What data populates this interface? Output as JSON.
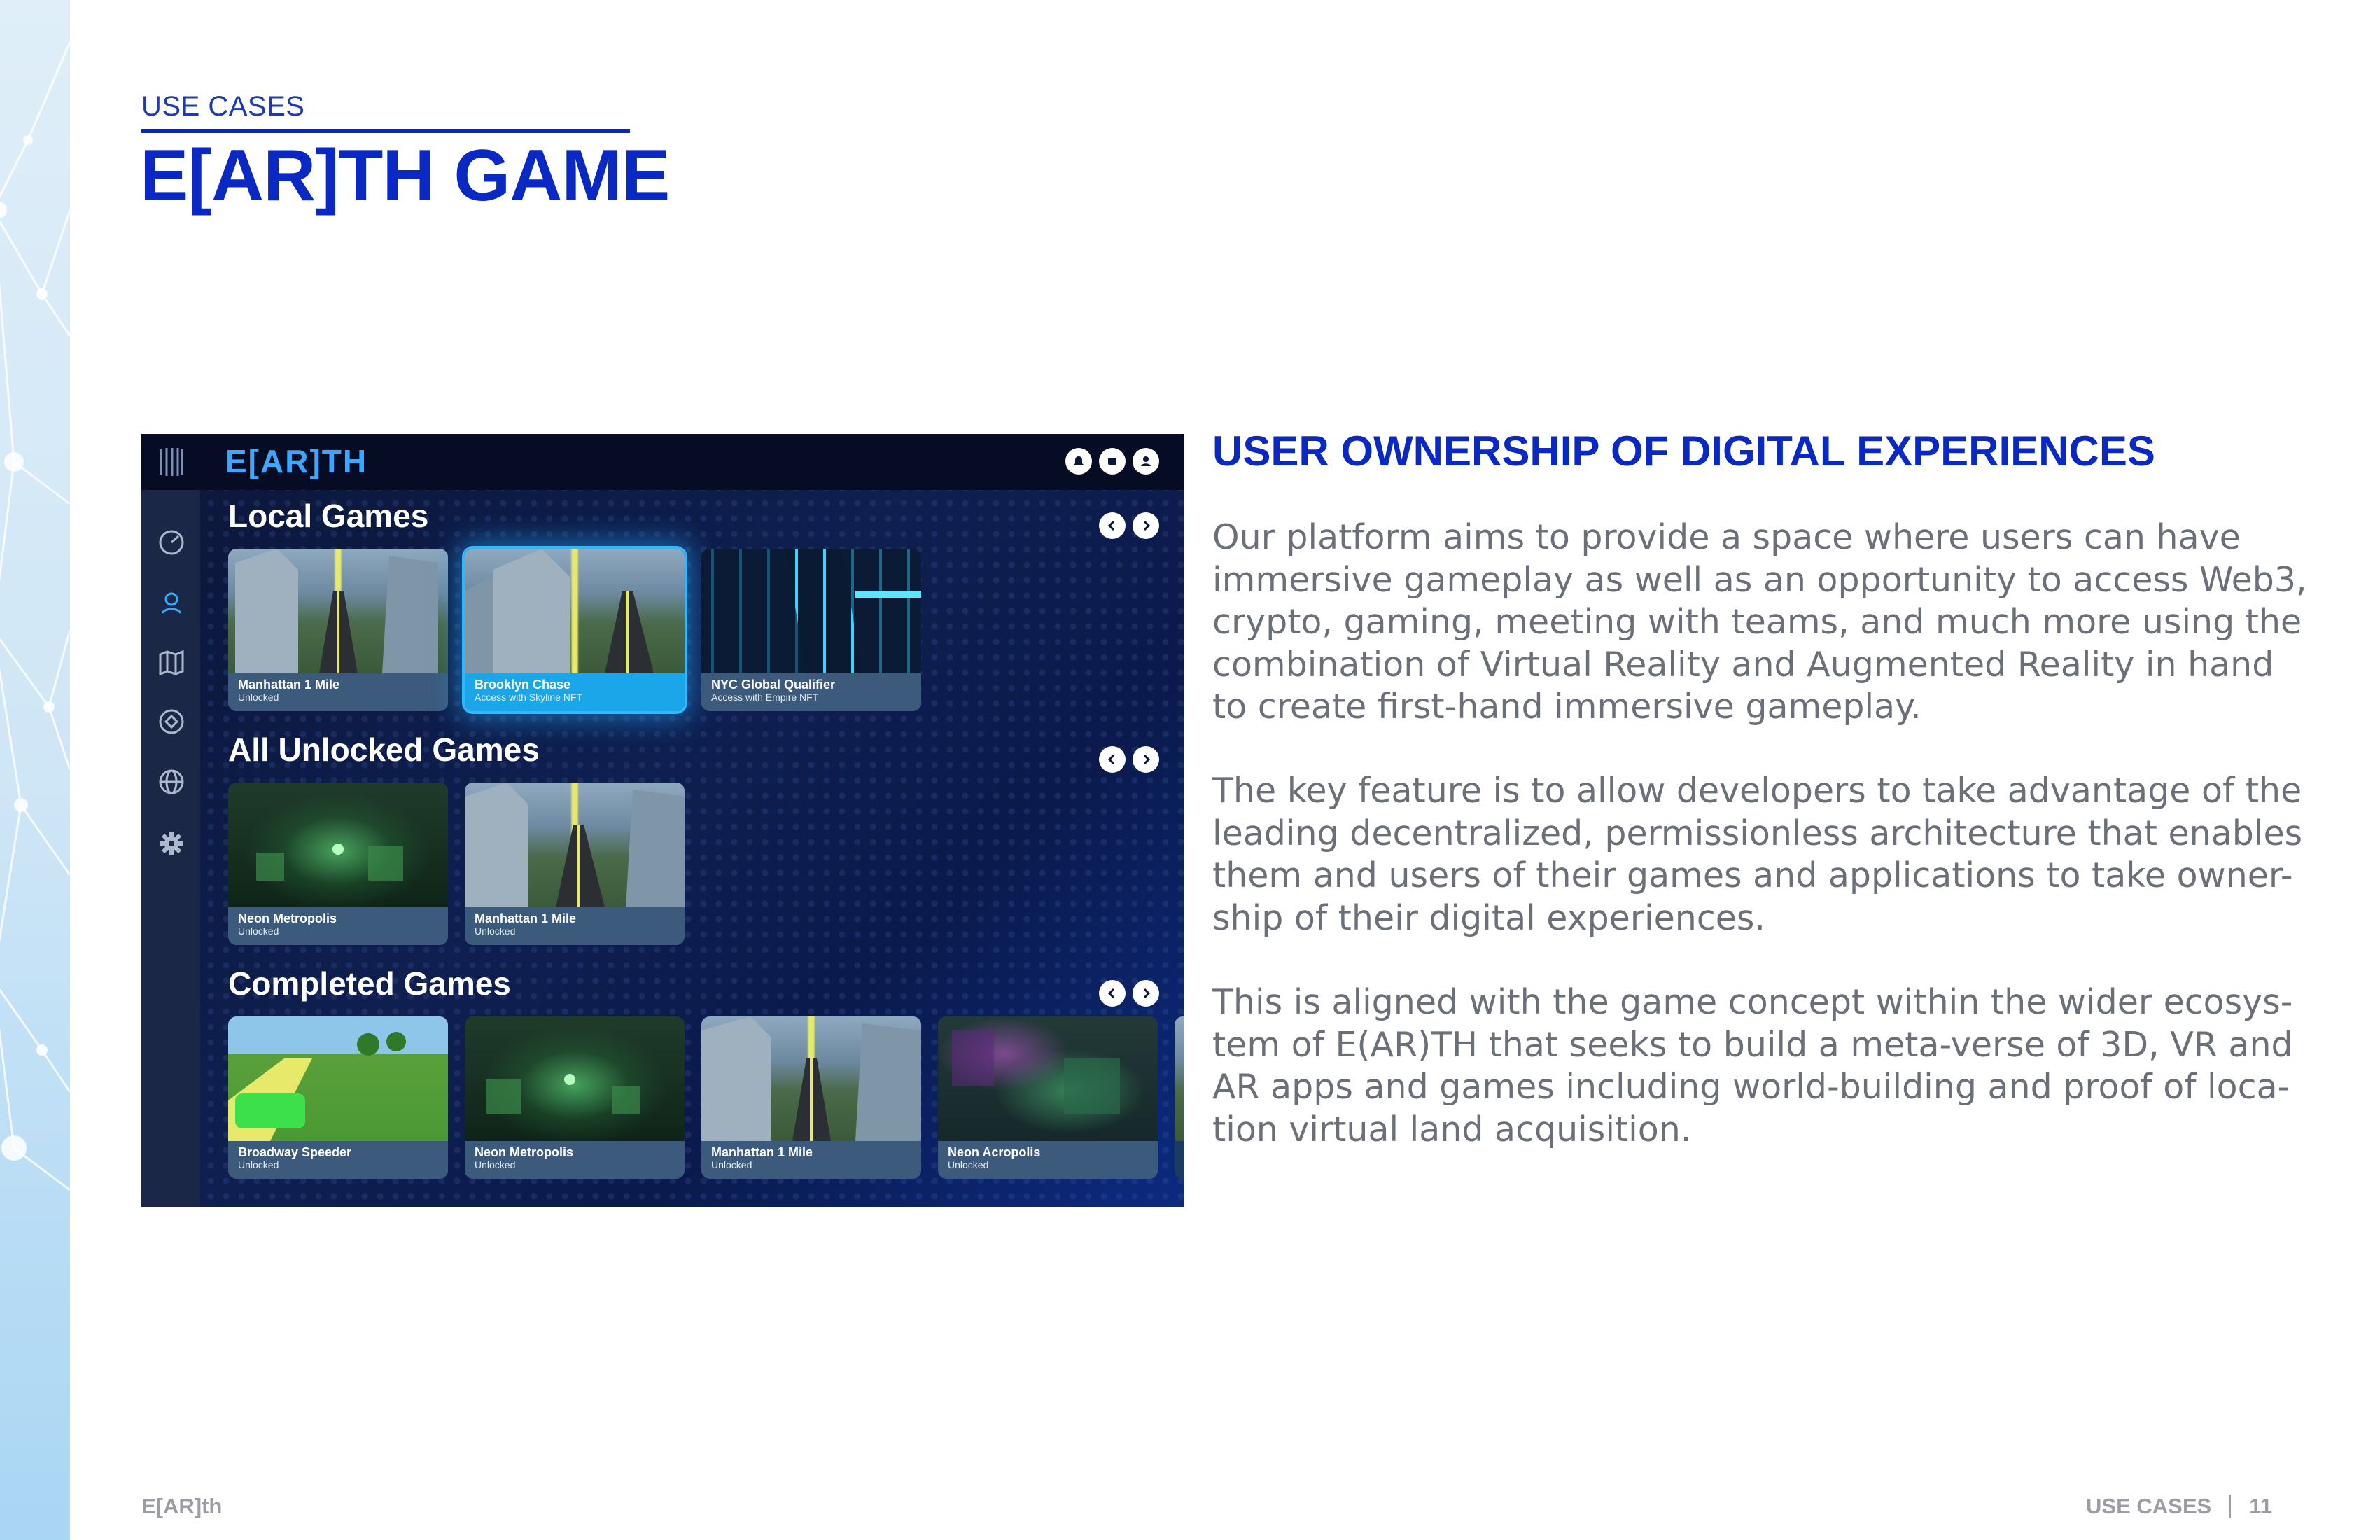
{
  "header": {
    "eyebrow": "USE CASES",
    "title": "E[AR]TH GAME"
  },
  "app": {
    "brand": "E[AR]TH",
    "topbar_icons": [
      "bell-icon",
      "wallet-icon",
      "profile-icon"
    ],
    "sidebar_icons": [
      "dashboard-icon",
      "location-pin-icon",
      "map-icon",
      "emblem-icon",
      "globe-icon",
      "settings-icon"
    ],
    "sections": [
      {
        "title": "Local Games",
        "cards": [
          {
            "name": "Manhattan 1 Mile",
            "status": "Unlocked",
            "thumb": "city"
          },
          {
            "name": "Brooklyn Chase",
            "status": "Access with Skyline NFT",
            "thumb": "city",
            "selected": true
          },
          {
            "name": "NYC Global Qualifier",
            "status": "Access with Empire NFT",
            "thumb": "cyber"
          }
        ]
      },
      {
        "title": "All Unlocked Games",
        "cards": [
          {
            "name": "Neon Metropolis",
            "status": "Unlocked",
            "thumb": "neon"
          },
          {
            "name": "Manhattan 1 Mile",
            "status": "Unlocked",
            "thumb": "city"
          }
        ]
      },
      {
        "title": "Completed Games",
        "cards": [
          {
            "name": "Broadway Speeder",
            "status": "Unlocked",
            "thumb": "green"
          },
          {
            "name": "Neon Metropolis",
            "status": "Unlocked",
            "thumb": "neon"
          },
          {
            "name": "Manhattan 1 Mile",
            "status": "Unlocked",
            "thumb": "city"
          },
          {
            "name": "Neon Acropolis",
            "status": "Unlocked",
            "thumb": "acro"
          }
        ]
      }
    ]
  },
  "content": {
    "heading": "USER OWNERSHIP OF DIGITAL EXPERIENCES",
    "paragraphs": [
      [
        "Our platform aims to provide a space where users can have",
        "immersive gameplay as well as an opportunity to access Web3,",
        "crypto, gaming, meeting with teams, and much more using  the",
        "combination of Virtual Reality and Augmented Reality in hand",
        "to create first-hand immersive gameplay."
      ],
      [
        "The key feature is to allow developers to take advantage of the",
        "leading decentralized, permissionless architecture that enables",
        "them and users of their games and applications to take owner-",
        "ship of their digital experiences."
      ],
      [
        "This is aligned with the game concept within the wider ecosys-",
        "tem of E(AR)TH that seeks to build a meta-verse of 3D, VR and",
        "AR apps and games including world-building and proof of loca-",
        "tion virtual land acquisition."
      ]
    ]
  },
  "footer": {
    "brand": "E[AR]th",
    "section": "USE CASES",
    "page_number": "11"
  }
}
